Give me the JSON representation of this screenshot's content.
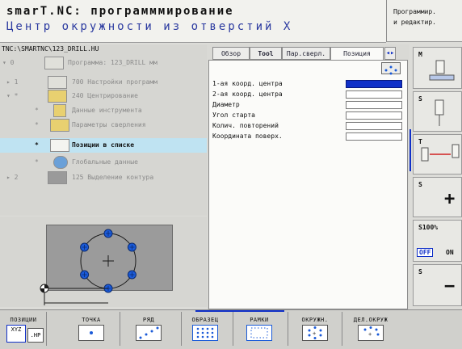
{
  "header": {
    "title": "smarT.NC: программмирование",
    "subtitle": "Центр окружности из отверстий X",
    "mode": [
      "Программир.",
      "и редактир."
    ]
  },
  "tree": {
    "path": "TNC:\\SMARTNC\\123_DRILL.HU",
    "items": [
      {
        "mark": "▾ 0",
        "label": "Программа: 123_DRILL мм"
      },
      {
        "mark": "▸ 1",
        "label": "700 Настройки программ"
      },
      {
        "mark": "▾ *",
        "label": "240 Центрирование"
      },
      {
        "mark": "*",
        "label": "Данные инструмента"
      },
      {
        "mark": "*",
        "label": "Параметры сверления"
      },
      {
        "mark": "*",
        "label": "Позиции в списке"
      },
      {
        "mark": "*",
        "label": "Глобальные данные"
      },
      {
        "mark": "▸ 2",
        "label": "125 Выделение контура"
      }
    ]
  },
  "tabs": [
    {
      "label": "Обзор"
    },
    {
      "label": "Tool"
    },
    {
      "label": "Пар.сверл."
    },
    {
      "label": "Позиция"
    }
  ],
  "form": {
    "fields": [
      {
        "label": "1-ая коорд. центра",
        "value": ""
      },
      {
        "label": "2-ая коорд. центра",
        "value": ""
      },
      {
        "label": "Диаметр",
        "value": ""
      },
      {
        "label": "Угол старта",
        "value": ""
      },
      {
        "label": "Колич. повторений",
        "value": ""
      },
      {
        "label": "Координата поверх.",
        "value": ""
      }
    ]
  },
  "softkeys_right": {
    "m": "M",
    "s": "S",
    "t": "T",
    "s_plus": "S",
    "s100": "S100%",
    "off": "OFF",
    "on": "ON",
    "s_minus": "S"
  },
  "softkeys_bottom": [
    {
      "label": "ПОЗИЦИИ",
      "icon": "xyz-hp-icon"
    },
    {
      "label": "ТОЧКА",
      "icon": "point-icon"
    },
    {
      "label": "РЯД",
      "icon": "row-icon"
    },
    {
      "label": "ОБРАЗЕЦ",
      "icon": "grid-pattern-icon"
    },
    {
      "label": "РАМКИ",
      "icon": "frame-pattern-icon"
    },
    {
      "label": "ОКРУЖН.",
      "icon": "circle-pattern-icon"
    },
    {
      "label": "ДЕЛ.ОКРУЖ",
      "icon": "arc-pattern-icon"
    }
  ],
  "drawing": {
    "type": "bolt-hole-circle",
    "holes": 6
  },
  "colors": {
    "accent": "#1030c8",
    "selection": "#bfe3f2",
    "hole": "#1a5ad8"
  }
}
